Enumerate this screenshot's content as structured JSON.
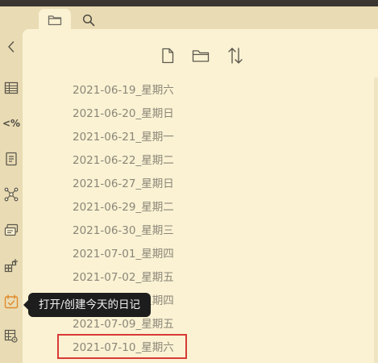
{
  "tabs": [
    {
      "icon": "folder-icon",
      "active": true
    },
    {
      "icon": "search-icon",
      "active": false
    }
  ],
  "sidebar": {
    "collapse_icon": "chevron-left-icon",
    "items": [
      {
        "icon": "table-icon"
      },
      {
        "icon": "templater-icon",
        "text": "<%"
      },
      {
        "icon": "form-icon"
      },
      {
        "icon": "graph-icon"
      },
      {
        "icon": "cards-icon"
      },
      {
        "icon": "add-block-icon"
      },
      {
        "icon": "daily-note-icon",
        "active": true
      },
      {
        "icon": "table-settings-icon"
      }
    ]
  },
  "toolbar": [
    {
      "icon": "new-note-icon"
    },
    {
      "icon": "new-folder-icon"
    },
    {
      "icon": "sort-icon"
    }
  ],
  "files": [
    "2021-06-19_星期六",
    "2021-06-20_星期日",
    "2021-06-21_星期一",
    "2021-06-22_星期二",
    "2021-06-27_星期日",
    "2021-06-29_星期二",
    "2021-06-30_星期三",
    "2021-07-01_星期四",
    "2021-07-02_星期五",
    "2021-07-08_星期四",
    "2021-07-09_星期五",
    "2021-07-10_星期六"
  ],
  "highlighted_file_index": 11,
  "tooltip": "打开/创建今天的日记",
  "colors": {
    "background": "#e9dcb4",
    "panel": "#faf2d3",
    "file_text": "#8c8678",
    "active_icon": "#e08a2c",
    "highlight": "#d83a36",
    "tooltip_bg": "#1d1d1d"
  }
}
